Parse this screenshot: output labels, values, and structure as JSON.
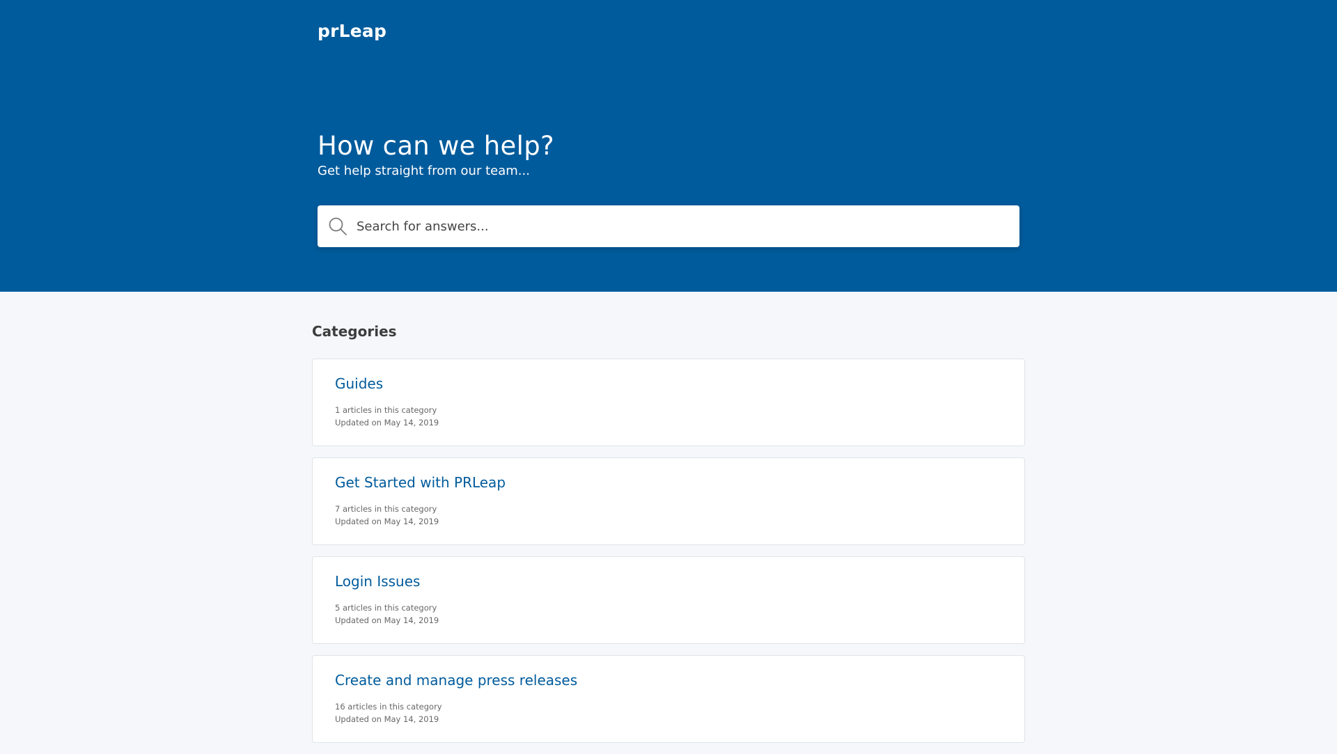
{
  "header": {
    "logo_text": "prLeap",
    "title": "How can we help?",
    "subtitle": "Get help straight from our team...",
    "search": {
      "placeholder": "Search for answers..."
    }
  },
  "colors": {
    "brand": "#005b9c",
    "page_background": "#f5f7fa",
    "card_background": "#ffffff"
  },
  "categories": {
    "heading": "Categories",
    "items": [
      {
        "title": "Guides",
        "count": "1 articles in this category",
        "updated": "Updated on May 14, 2019"
      },
      {
        "title": "Get Started with PRLeap",
        "count": "7 articles in this category",
        "updated": "Updated on May 14, 2019"
      },
      {
        "title": "Login Issues",
        "count": "5 articles in this category",
        "updated": "Updated on May 14, 2019"
      },
      {
        "title": "Create and manage press releases",
        "count": "16 articles in this category",
        "updated": "Updated on May 14, 2019"
      }
    ]
  }
}
